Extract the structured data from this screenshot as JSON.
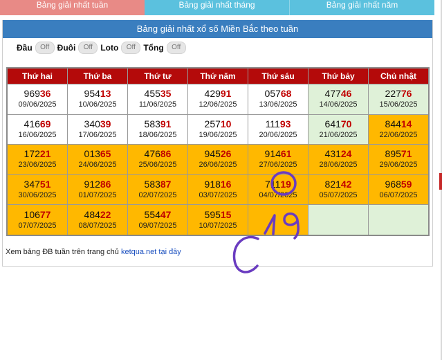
{
  "nav": {
    "tabs": [
      "Bảng giải nhất tuần",
      "Bảng giải nhất tháng",
      "Bảng giải nhất năm"
    ]
  },
  "panel": {
    "title": "Bảng giải nhất xổ số Miền Bắc theo tuần"
  },
  "filters": [
    {
      "label": "Đầu",
      "state": "Off"
    },
    {
      "label": "Đuôi",
      "state": "Off"
    },
    {
      "label": "Loto",
      "state": "Off"
    },
    {
      "label": "Tổng",
      "state": "Off"
    }
  ],
  "table": {
    "headers": [
      "Thứ hai",
      "Thứ ba",
      "Thứ tư",
      "Thứ năm",
      "Thứ sáu",
      "Thứ bảy",
      "Chủ nhật"
    ],
    "rows": [
      [
        {
          "head": "969",
          "tail": "36",
          "date": "09/06/2025",
          "bg": "w"
        },
        {
          "head": "954",
          "tail": "13",
          "date": "10/06/2025",
          "bg": "w"
        },
        {
          "head": "455",
          "tail": "35",
          "date": "11/06/2025",
          "bg": "w"
        },
        {
          "head": "429",
          "tail": "91",
          "date": "12/06/2025",
          "bg": "w"
        },
        {
          "head": "057",
          "tail": "68",
          "date": "13/06/2025",
          "bg": "w"
        },
        {
          "head": "477",
          "tail": "46",
          "date": "14/06/2025",
          "bg": "g"
        },
        {
          "head": "227",
          "tail": "76",
          "date": "15/06/2025",
          "bg": "g"
        }
      ],
      [
        {
          "head": "416",
          "tail": "69",
          "date": "16/06/2025",
          "bg": "w"
        },
        {
          "head": "340",
          "tail": "39",
          "date": "17/06/2025",
          "bg": "w"
        },
        {
          "head": "583",
          "tail": "91",
          "date": "18/06/2025",
          "bg": "w"
        },
        {
          "head": "257",
          "tail": "10",
          "date": "19/06/2025",
          "bg": "w"
        },
        {
          "head": "111",
          "tail": "93",
          "date": "20/06/2025",
          "bg": "w"
        },
        {
          "head": "641",
          "tail": "70",
          "date": "21/06/2025",
          "bg": "g"
        },
        {
          "head": "844",
          "tail": "14",
          "date": "22/06/2025",
          "bg": "y"
        }
      ],
      [
        {
          "head": "172",
          "tail": "21",
          "date": "23/06/2025",
          "bg": "y"
        },
        {
          "head": "013",
          "tail": "65",
          "date": "24/06/2025",
          "bg": "y"
        },
        {
          "head": "476",
          "tail": "86",
          "date": "25/06/2025",
          "bg": "y"
        },
        {
          "head": "945",
          "tail": "26",
          "date": "26/06/2025",
          "bg": "y"
        },
        {
          "head": "914",
          "tail": "61",
          "date": "27/06/2025",
          "bg": "y"
        },
        {
          "head": "431",
          "tail": "24",
          "date": "28/06/2025",
          "bg": "y"
        },
        {
          "head": "895",
          "tail": "71",
          "date": "29/06/2025",
          "bg": "y"
        }
      ],
      [
        {
          "head": "347",
          "tail": "51",
          "date": "30/06/2025",
          "bg": "y"
        },
        {
          "head": "912",
          "tail": "86",
          "date": "01/07/2025",
          "bg": "y"
        },
        {
          "head": "583",
          "tail": "87",
          "date": "02/07/2025",
          "bg": "y"
        },
        {
          "head": "918",
          "tail": "16",
          "date": "03/07/2025",
          "bg": "y"
        },
        {
          "head": "711",
          "tail": "19",
          "date": "04/07/2025",
          "bg": "y"
        },
        {
          "head": "821",
          "tail": "42",
          "date": "05/07/2025",
          "bg": "y"
        },
        {
          "head": "968",
          "tail": "59",
          "date": "06/07/2025",
          "bg": "y"
        }
      ],
      [
        {
          "head": "106",
          "tail": "77",
          "date": "07/07/2025",
          "bg": "y"
        },
        {
          "head": "484",
          "tail": "22",
          "date": "08/07/2025",
          "bg": "y"
        },
        {
          "head": "554",
          "tail": "47",
          "date": "09/07/2025",
          "bg": "y"
        },
        {
          "head": "595",
          "tail": "15",
          "date": "10/07/2025",
          "bg": "y"
        },
        {
          "head": "",
          "tail": "",
          "date": "",
          "bg": "y"
        },
        {
          "head": "",
          "tail": "",
          "date": "",
          "bg": "g"
        },
        {
          "head": "",
          "tail": "",
          "date": "",
          "bg": "g"
        }
      ]
    ]
  },
  "footnote": {
    "text": "Xem bảng ĐB tuần trên trang chủ",
    "link1": "ketqua.net",
    "link2": "tại đây"
  },
  "annotation": {
    "handwritten": "19",
    "color": "#6a3cc0"
  },
  "colors": {
    "header_red": "#b40a0a",
    "highlight_yellow": "#ffb800",
    "weekend_green": "#dff1d8",
    "title_blue": "#3a7ebf"
  }
}
